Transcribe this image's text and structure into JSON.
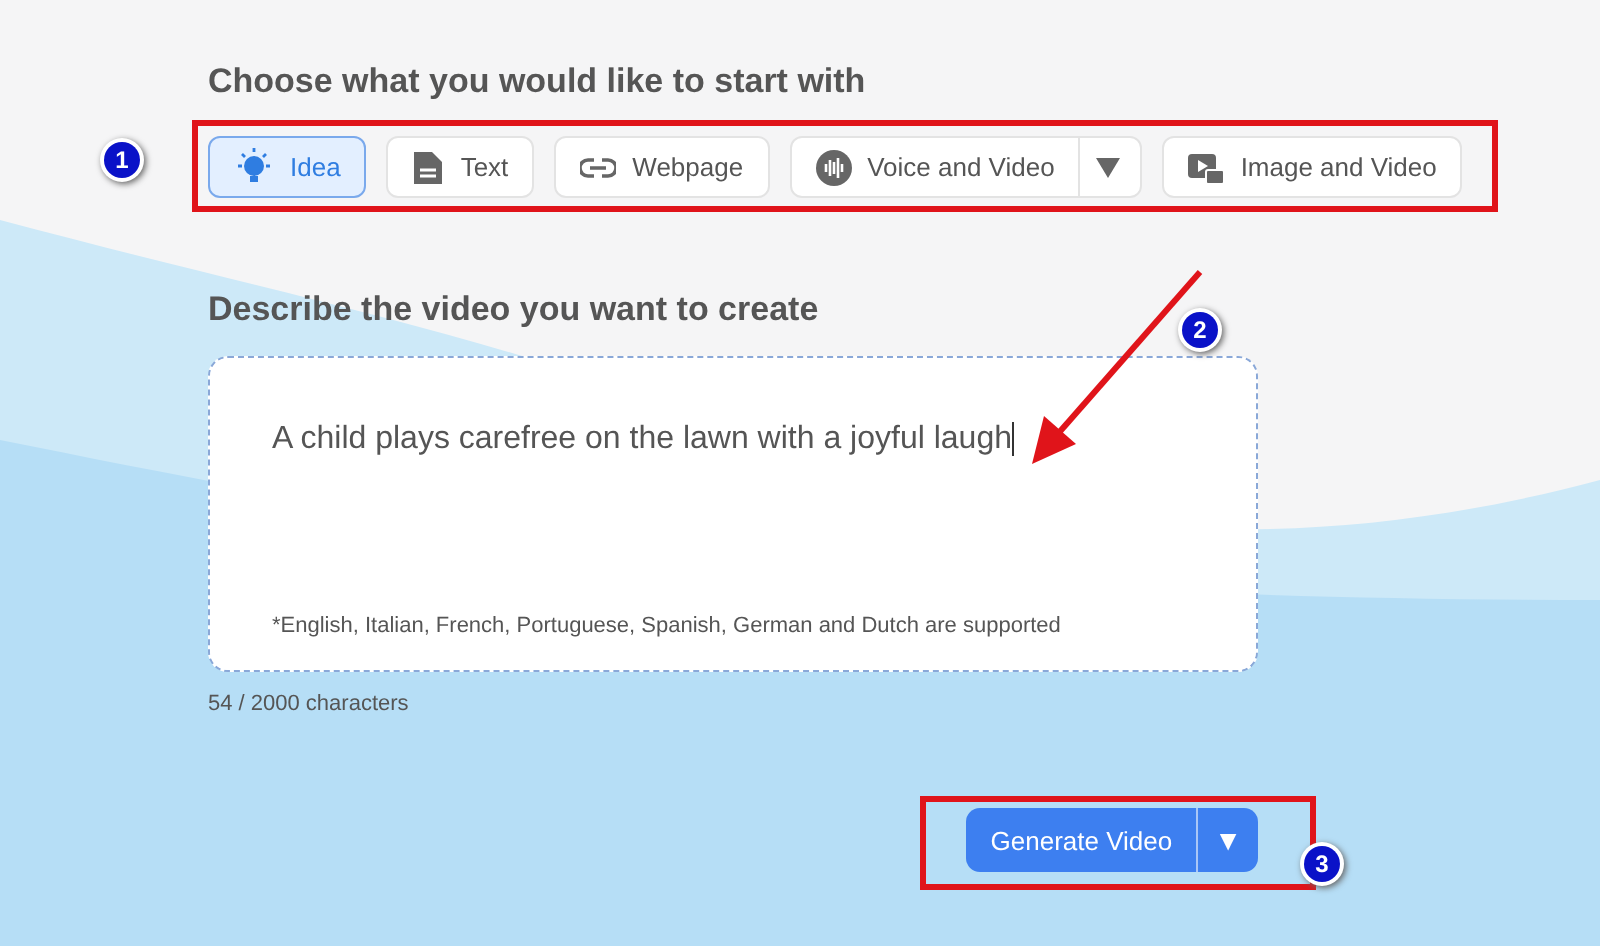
{
  "start_section": {
    "title": "Choose what you would like to start with",
    "options": [
      {
        "label": "Idea",
        "selected": true,
        "kind": "plain"
      },
      {
        "label": "Text",
        "selected": false,
        "kind": "plain"
      },
      {
        "label": "Webpage",
        "selected": false,
        "kind": "plain"
      },
      {
        "label": "Voice and Video",
        "selected": false,
        "kind": "split"
      },
      {
        "label": "Image and Video",
        "selected": false,
        "kind": "plain"
      }
    ]
  },
  "describe_section": {
    "title": "Describe the video you want to create",
    "value": "A child plays carefree on the lawn with a joyful laugh",
    "note": "*English, Italian, French, Portuguese, Spanish, German and Dutch are supported",
    "counter": "54 / 2000 characters"
  },
  "generate_button": {
    "label": "Generate Video",
    "caret": "▼"
  },
  "annotations": [
    {
      "label": "1"
    },
    {
      "label": "2"
    },
    {
      "label": "3"
    }
  ]
}
